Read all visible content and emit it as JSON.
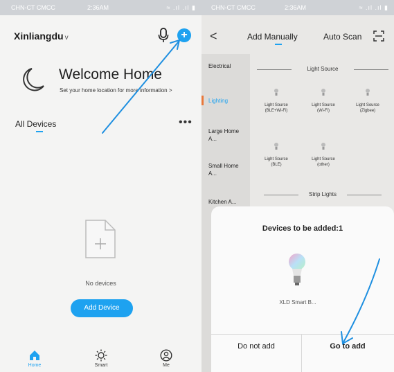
{
  "left": {
    "status": {
      "carrier": "CHN-CT CMCC",
      "time": "2:36AM",
      "icons": "≈ .ıl .ıl ▮"
    },
    "header": {
      "home_name": "Xinliangdu",
      "caret": "v",
      "add_symbol": "+"
    },
    "welcome": {
      "title": "Welcome Home",
      "subtitle": "Set your home location for more information >"
    },
    "devices": {
      "title": "All Devices",
      "more": "•••"
    },
    "empty": {
      "text": "No devices",
      "button": "Add Device"
    },
    "nav": [
      {
        "label": "Home",
        "icon": "home-icon"
      },
      {
        "label": "Smart",
        "icon": "sun-icon"
      },
      {
        "label": "Me",
        "icon": "me-icon"
      }
    ]
  },
  "right": {
    "status": {
      "carrier": "CHN-CT CMCC",
      "time": "2:36AM",
      "icons": "≈ .ıl .ıl ▮"
    },
    "header": {
      "back": "<",
      "tab_manual": "Add Manually",
      "tab_scan": "Auto Scan"
    },
    "categories": [
      {
        "label": "Electrical"
      },
      {
        "label": "Lighting"
      },
      {
        "label": "Large Home A..."
      },
      {
        "label": "Small Home A..."
      },
      {
        "label": "Kitchen A..."
      }
    ],
    "sections": {
      "light_source": "Light Source",
      "strip_lights": "Strip Lights"
    },
    "products": [
      {
        "line1": "Light Source",
        "line2": "(BLE+Wi-Fi)"
      },
      {
        "line1": "Light Source",
        "line2": "(Wi-Fi)"
      },
      {
        "line1": "Light Source",
        "line2": "(Zigbee)"
      },
      {
        "line1": "Light Source",
        "line2": "(BLE)"
      },
      {
        "line1": "Light Source",
        "line2": "(other)"
      }
    ],
    "sheet": {
      "title": "Devices to be added:1",
      "device_name": "XLD Smart B...",
      "cancel": "Do not add",
      "confirm": "Go to add"
    }
  },
  "colors": {
    "accent": "#1ea2f0",
    "annotation_arrow": "#1e8fe0"
  }
}
